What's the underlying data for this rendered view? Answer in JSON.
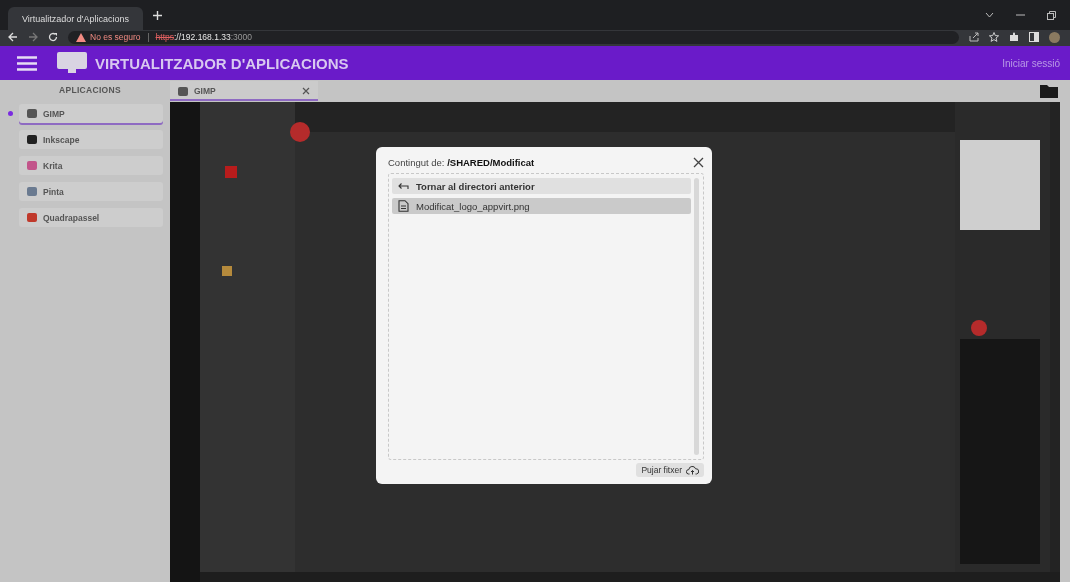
{
  "browser": {
    "tabs": [
      {
        "title": "Virtualitzador d'Aplicacions",
        "selected": true
      }
    ],
    "address": {
      "warning": "No es seguro",
      "scheme": "https",
      "host": "://192.168.1.33",
      "port": ":3000"
    }
  },
  "header": {
    "title": "VIRTUALITZADOR D'APLICACIONS",
    "login": "Iniciar sessió"
  },
  "sidebar": {
    "heading": "APLICACIONS",
    "items": [
      {
        "label": "GIMP",
        "selected": true
      },
      {
        "label": "Inkscape",
        "selected": false
      },
      {
        "label": "Krita",
        "selected": false
      },
      {
        "label": "Pinta",
        "selected": false
      },
      {
        "label": "Quadrapassel",
        "selected": false
      }
    ]
  },
  "open_tabs": [
    {
      "label": "GIMP",
      "selected": true
    }
  ],
  "dialog": {
    "title": "Contingut de: **/SHARED/Modificat**",
    "entries": [
      {
        "kind": "back",
        "label": "Tornar al directori anterior",
        "hovered": false
      },
      {
        "kind": "file",
        "label": "Modificat_logo_appvirt.png",
        "hovered": true
      }
    ],
    "upload_button": "Pujar fitxer"
  }
}
